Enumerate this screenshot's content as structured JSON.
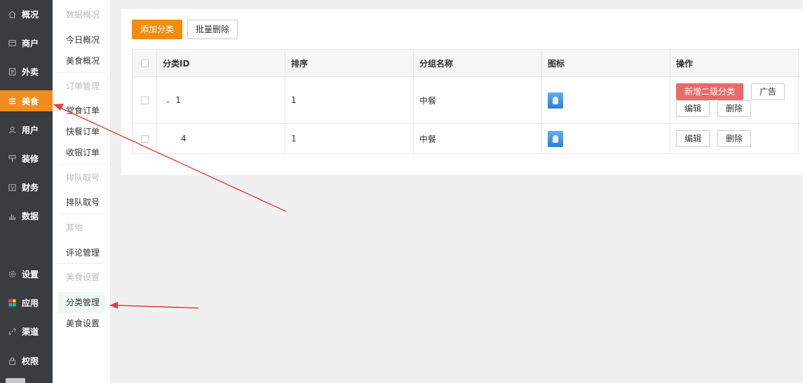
{
  "primary_nav": {
    "items": [
      {
        "label": "概况",
        "icon": "home-icon"
      },
      {
        "label": "商户",
        "icon": "store-icon"
      },
      {
        "label": "外卖",
        "icon": "document-icon"
      },
      {
        "label": "美食",
        "icon": "menu-icon",
        "active": true
      },
      {
        "label": "用户",
        "icon": "user-icon"
      },
      {
        "label": "装修",
        "icon": "decorate-icon"
      },
      {
        "label": "财务",
        "icon": "finance-icon"
      },
      {
        "label": "数据",
        "icon": "chart-icon"
      },
      {
        "label": "设置",
        "icon": "gear-icon"
      },
      {
        "label": "应用",
        "icon": "apps-icon"
      },
      {
        "label": "渠道",
        "icon": "link-icon"
      },
      {
        "label": "权限",
        "icon": "lock-icon"
      }
    ]
  },
  "secondary_nav": {
    "groups": [
      {
        "title": "数据概况",
        "items": [
          "今日概况",
          "美食概况"
        ]
      },
      {
        "title": "订单管理",
        "items": [
          "堂食订单",
          "快餐订单",
          "收银订单"
        ]
      },
      {
        "title": "排队取号",
        "items": [
          "排队取号"
        ]
      },
      {
        "title": "其他",
        "items": [
          "评论管理"
        ]
      },
      {
        "title": "美食设置",
        "items": [
          "分类管理",
          "美食设置"
        ]
      }
    ],
    "active_item": "分类管理"
  },
  "toolbar": {
    "add_label": "添加分类",
    "batch_delete_label": "批量删除"
  },
  "table": {
    "headers": [
      "分类ID",
      "排序",
      "分组名称",
      "图标",
      "操作"
    ],
    "rows": [
      {
        "id": "1",
        "sort": "1",
        "group": "中餐",
        "icon": "category-image",
        "expandable": true,
        "actions": [
          "新增二级分类",
          "广告",
          "编辑",
          "删除"
        ]
      },
      {
        "id": "4",
        "sort": "1",
        "group": "中餐",
        "icon": "category-image",
        "expandable": false,
        "actions": [
          "编辑",
          "删除"
        ]
      }
    ]
  },
  "colors": {
    "accent": "#f28c1a",
    "sidebar_bg": "#393d40",
    "danger": "#e86b6b",
    "annotation_arrow": "#e8403a"
  }
}
